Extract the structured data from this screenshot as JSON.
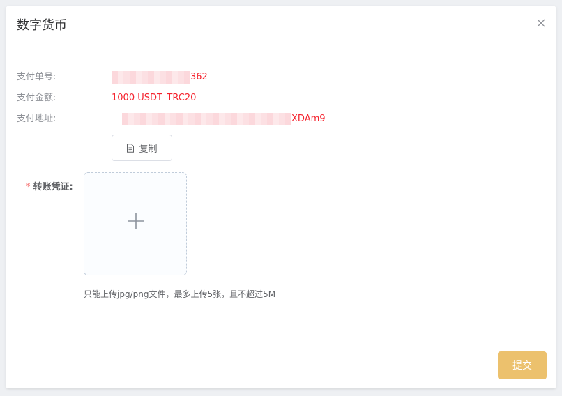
{
  "dialog": {
    "title": "数字货币"
  },
  "payment": {
    "order_no": {
      "label": "支付单号:",
      "value_suffix": "362"
    },
    "amount": {
      "label": "支付金额:",
      "value": "1000 USDT_TRC20"
    },
    "address": {
      "label": "支付地址:",
      "value_suffix": "XDAm9"
    }
  },
  "copy_button": {
    "label": "复制",
    "icon": "document-icon"
  },
  "voucher": {
    "required_mark": "*",
    "label": "转账凭证:",
    "upload_icon": "plus-icon",
    "tip": "只能上传jpg/png文件，最多上传5张，且不超过5M"
  },
  "submit_button": {
    "label": "提交"
  },
  "colors": {
    "value_red": "#f5222d",
    "submit_bg": "#ecc16d",
    "required_red": "#f56c6c"
  }
}
